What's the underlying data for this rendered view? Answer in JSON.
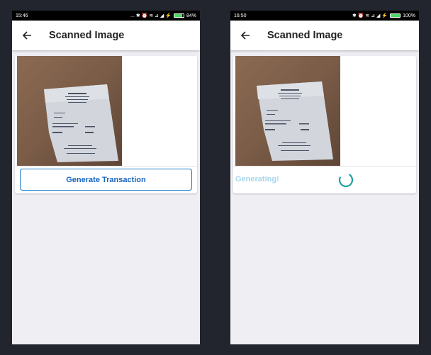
{
  "screens": [
    {
      "status": {
        "time": "15:46",
        "icons": "... ✱ ⏰ ≋ ⊿ ◢ ⚡",
        "battery_pct": "84%",
        "battery_level": 0.84
      },
      "app_bar": {
        "title": "Scanned Image"
      },
      "button": {
        "label": "Generate Transaction"
      }
    },
    {
      "status": {
        "time": "16:50",
        "icons": "✱ ⏰ ≋ ⊿ ◢ ⚡",
        "battery_pct": "100%",
        "battery_level": 1.0
      },
      "app_bar": {
        "title": "Scanned Image"
      },
      "loading": {
        "label": "Generating!"
      }
    }
  ],
  "receipt_text": {
    "header": "MANEVALOUN",
    "lines": [
      "14/09/2018",
      "TABLE 05",
      "1  RED CAP 15 $ 8",
      "TOTAL",
      "$8.40",
      "HA OPTIONAL 12.5%",
      "THANK YOU FOR YOUR CUSTOM"
    ]
  },
  "colors": {
    "background": "#22252e",
    "accent": "#1565c0",
    "spinner": "#1aa3a3",
    "generating_text": "#a6d6ee"
  }
}
